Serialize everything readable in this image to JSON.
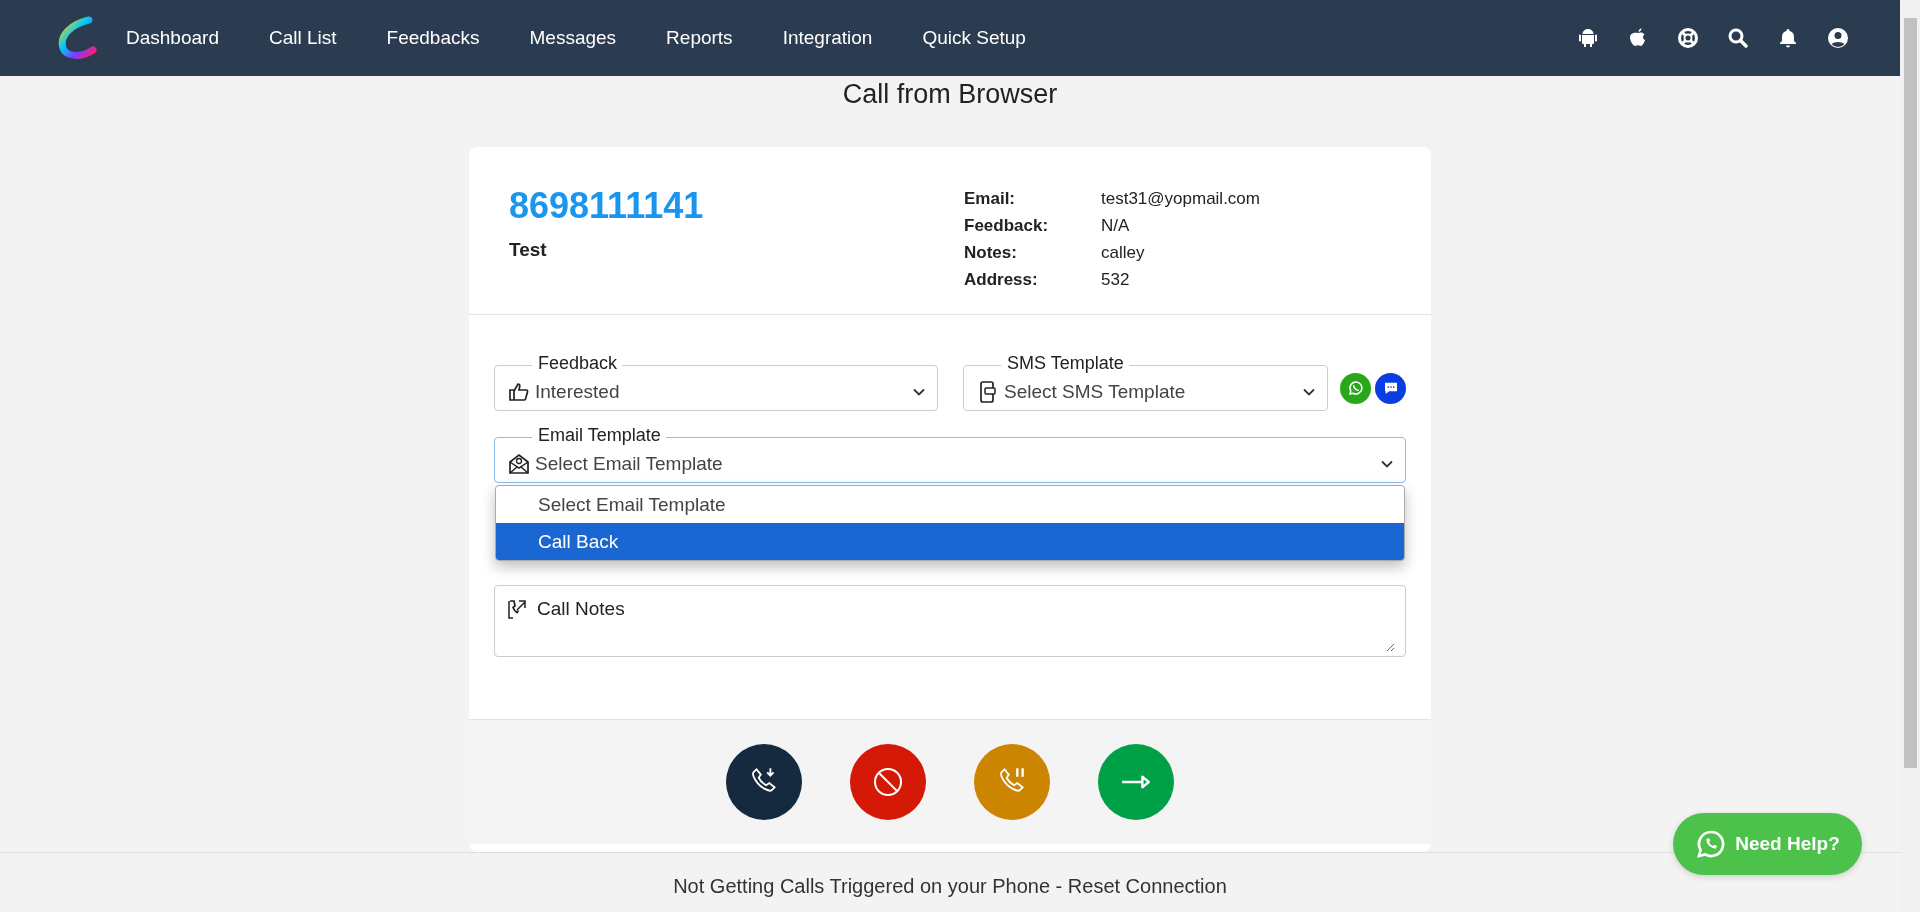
{
  "nav": {
    "items": [
      "Dashboard",
      "Call List",
      "Feedbacks",
      "Messages",
      "Reports",
      "Integration",
      "Quick Setup"
    ]
  },
  "page_title": "Call from Browser",
  "contact": {
    "phone": "8698111141",
    "name": "Test",
    "details": [
      {
        "label": "Email:",
        "value": "test31@yopmail.com"
      },
      {
        "label": "Feedback:",
        "value": "N/A"
      },
      {
        "label": "Notes:",
        "value": "calley"
      },
      {
        "label": "Address:",
        "value": "532"
      }
    ]
  },
  "form": {
    "feedback": {
      "label": "Feedback",
      "value": "Interested"
    },
    "sms_template": {
      "label": "SMS Template",
      "value": "Select SMS Template"
    },
    "email_template": {
      "label": "Email Template",
      "value": "Select Email Template",
      "expanded": true,
      "options": [
        {
          "label": "Select Email Template",
          "highlighted": false
        },
        {
          "label": "Call Back",
          "highlighted": true
        }
      ]
    },
    "call_notes": {
      "placeholder": "Call Notes"
    }
  },
  "call_actions": [
    {
      "kind": "callback",
      "color": "#15293f"
    },
    {
      "kind": "block",
      "color": "#d41a06"
    },
    {
      "kind": "hold",
      "color": "#cc8500"
    },
    {
      "kind": "next",
      "color": "#00a046"
    }
  ],
  "reset_text": "Not Getting Calls Triggered on your Phone - Reset Connection",
  "help_button": "Need Help?"
}
